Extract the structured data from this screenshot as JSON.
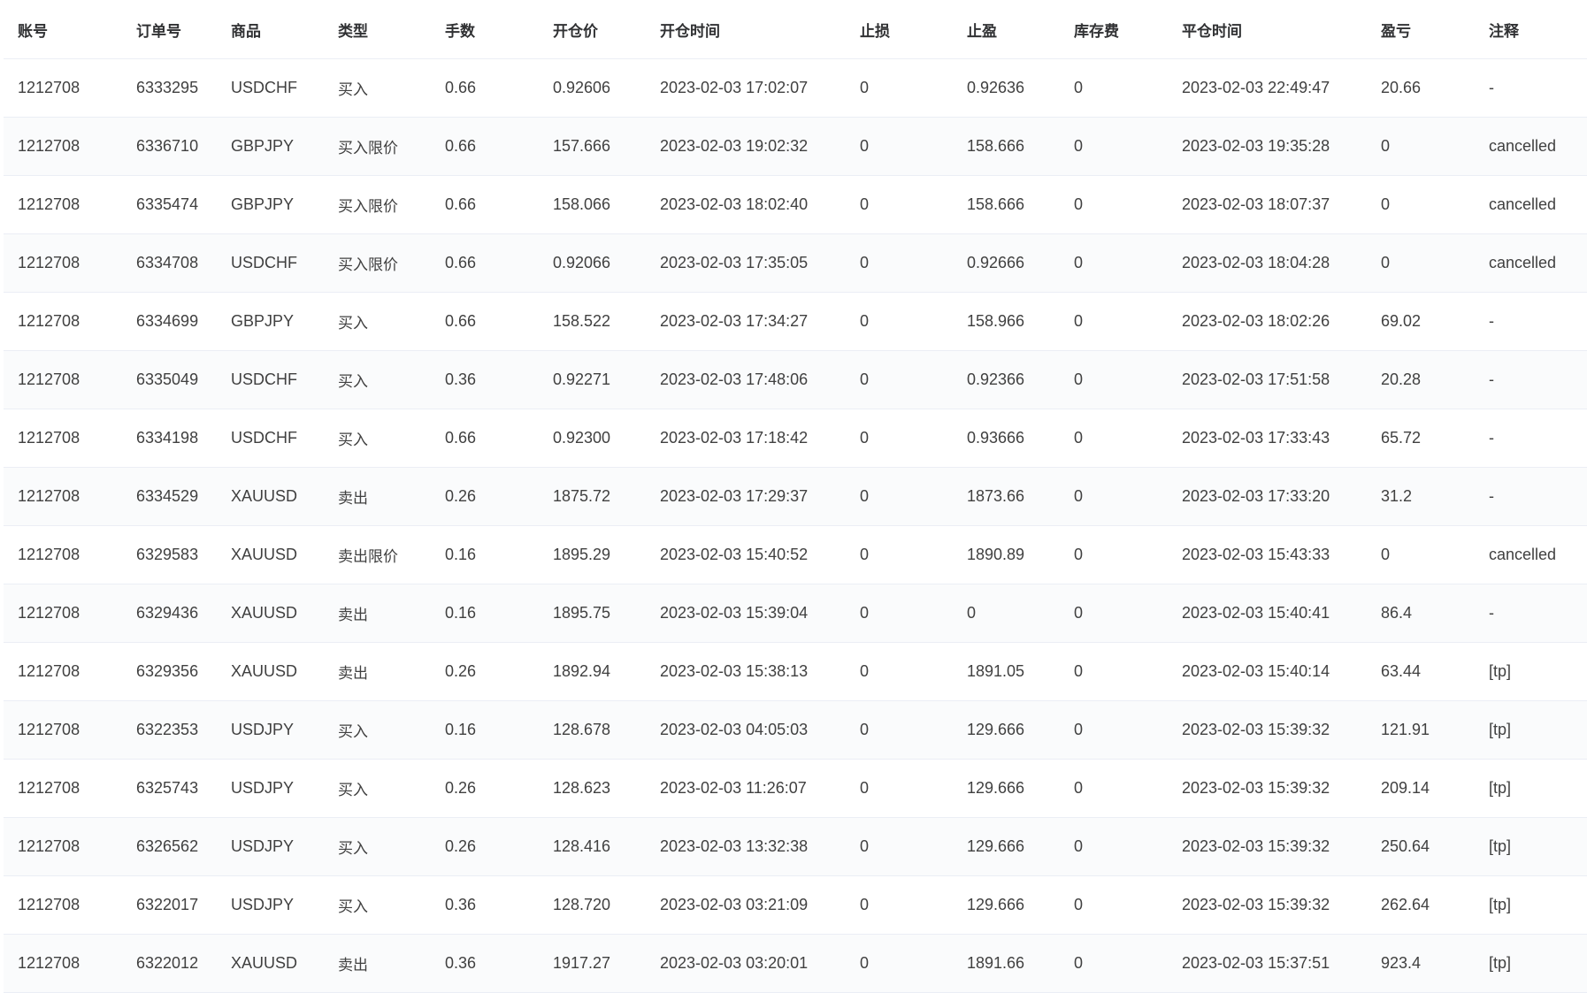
{
  "table": {
    "columns": [
      "账号",
      "订单号",
      "商品",
      "类型",
      "手数",
      "开仓价",
      "开仓时间",
      "止损",
      "止盈",
      "库存费",
      "平仓时间",
      "盈亏",
      "注释"
    ],
    "rows": [
      [
        "1212708",
        "6333295",
        "USDCHF",
        "买入",
        "0.66",
        "0.92606",
        "2023-02-03 17:02:07",
        "0",
        "0.92636",
        "0",
        "2023-02-03 22:49:47",
        "20.66",
        "-"
      ],
      [
        "1212708",
        "6336710",
        "GBPJPY",
        "买入限价",
        "0.66",
        "157.666",
        "2023-02-03 19:02:32",
        "0",
        "158.666",
        "0",
        "2023-02-03 19:35:28",
        "0",
        "cancelled"
      ],
      [
        "1212708",
        "6335474",
        "GBPJPY",
        "买入限价",
        "0.66",
        "158.066",
        "2023-02-03 18:02:40",
        "0",
        "158.666",
        "0",
        "2023-02-03 18:07:37",
        "0",
        "cancelled"
      ],
      [
        "1212708",
        "6334708",
        "USDCHF",
        "买入限价",
        "0.66",
        "0.92066",
        "2023-02-03 17:35:05",
        "0",
        "0.92666",
        "0",
        "2023-02-03 18:04:28",
        "0",
        "cancelled"
      ],
      [
        "1212708",
        "6334699",
        "GBPJPY",
        "买入",
        "0.66",
        "158.522",
        "2023-02-03 17:34:27",
        "0",
        "158.966",
        "0",
        "2023-02-03 18:02:26",
        "69.02",
        "-"
      ],
      [
        "1212708",
        "6335049",
        "USDCHF",
        "买入",
        "0.36",
        "0.92271",
        "2023-02-03 17:48:06",
        "0",
        "0.92366",
        "0",
        "2023-02-03 17:51:58",
        "20.28",
        "-"
      ],
      [
        "1212708",
        "6334198",
        "USDCHF",
        "买入",
        "0.66",
        "0.92300",
        "2023-02-03 17:18:42",
        "0",
        "0.93666",
        "0",
        "2023-02-03 17:33:43",
        "65.72",
        "-"
      ],
      [
        "1212708",
        "6334529",
        "XAUUSD",
        "卖出",
        "0.26",
        "1875.72",
        "2023-02-03 17:29:37",
        "0",
        "1873.66",
        "0",
        "2023-02-03 17:33:20",
        "31.2",
        "-"
      ],
      [
        "1212708",
        "6329583",
        "XAUUSD",
        "卖出限价",
        "0.16",
        "1895.29",
        "2023-02-03 15:40:52",
        "0",
        "1890.89",
        "0",
        "2023-02-03 15:43:33",
        "0",
        "cancelled"
      ],
      [
        "1212708",
        "6329436",
        "XAUUSD",
        "卖出",
        "0.16",
        "1895.75",
        "2023-02-03 15:39:04",
        "0",
        "0",
        "0",
        "2023-02-03 15:40:41",
        "86.4",
        "-"
      ],
      [
        "1212708",
        "6329356",
        "XAUUSD",
        "卖出",
        "0.26",
        "1892.94",
        "2023-02-03 15:38:13",
        "0",
        "1891.05",
        "0",
        "2023-02-03 15:40:14",
        "63.44",
        "[tp]"
      ],
      [
        "1212708",
        "6322353",
        "USDJPY",
        "买入",
        "0.16",
        "128.678",
        "2023-02-03 04:05:03",
        "0",
        "129.666",
        "0",
        "2023-02-03 15:39:32",
        "121.91",
        "[tp]"
      ],
      [
        "1212708",
        "6325743",
        "USDJPY",
        "买入",
        "0.26",
        "128.623",
        "2023-02-03 11:26:07",
        "0",
        "129.666",
        "0",
        "2023-02-03 15:39:32",
        "209.14",
        "[tp]"
      ],
      [
        "1212708",
        "6326562",
        "USDJPY",
        "买入",
        "0.26",
        "128.416",
        "2023-02-03 13:32:38",
        "0",
        "129.666",
        "0",
        "2023-02-03 15:39:32",
        "250.64",
        "[tp]"
      ],
      [
        "1212708",
        "6322017",
        "USDJPY",
        "买入",
        "0.36",
        "128.720",
        "2023-02-03 03:21:09",
        "0",
        "129.666",
        "0",
        "2023-02-03 15:39:32",
        "262.64",
        "[tp]"
      ],
      [
        "1212708",
        "6322012",
        "XAUUSD",
        "卖出",
        "0.36",
        "1917.27",
        "2023-02-03 03:20:01",
        "0",
        "1891.66",
        "0",
        "2023-02-03 15:37:51",
        "923.4",
        "[tp]"
      ]
    ]
  }
}
